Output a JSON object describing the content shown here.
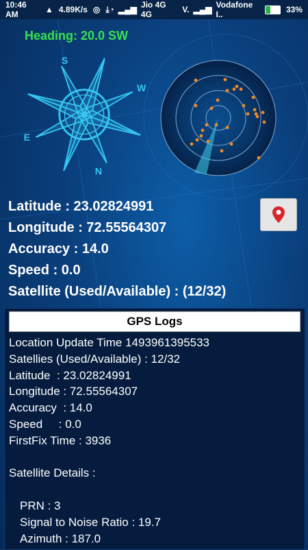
{
  "status_bar": {
    "time": "10:46 AM",
    "speed": "4.89K/s",
    "carrier1": "Jio 4G 4G",
    "carrier1_suffix": "V.",
    "carrier2": "Vodafone I..",
    "battery": "33%"
  },
  "heading": "Heading: 20.0 SW",
  "compass": {
    "letters": [
      "S",
      "W",
      "N",
      "E"
    ],
    "rotation_deg": 20
  },
  "info": {
    "latitude": "Latitude : 23.02824991",
    "longitude": "Longitude : 72.55564307",
    "accuracy": "Accuracy : 14.0",
    "speed": "Speed : 0.0",
    "satellite": "Satellite (Used/Available) : (12/32)"
  },
  "map_button_icon": "map-pin-icon",
  "logs": {
    "title": "GPS Logs",
    "lines": [
      "Location Update Time 1493961395533",
      "Satellies (Used/Available) : 12/32",
      "Latitude  : 23.02824991",
      "Longitude : 72.55564307",
      "Accuracy  : 14.0",
      "Speed     : 0.0",
      "FirstFix Time : 3936",
      "",
      "Satellite Details :",
      ""
    ],
    "satellite_lines": [
      "PRN : 3",
      "Signal to Noise Ratio : 19.7",
      "Azimuth : 187.0"
    ]
  },
  "colors": {
    "heading": "#39e24b",
    "compass": "#35c6f2",
    "dots": "#f08a24",
    "pin": "#d9252a"
  }
}
